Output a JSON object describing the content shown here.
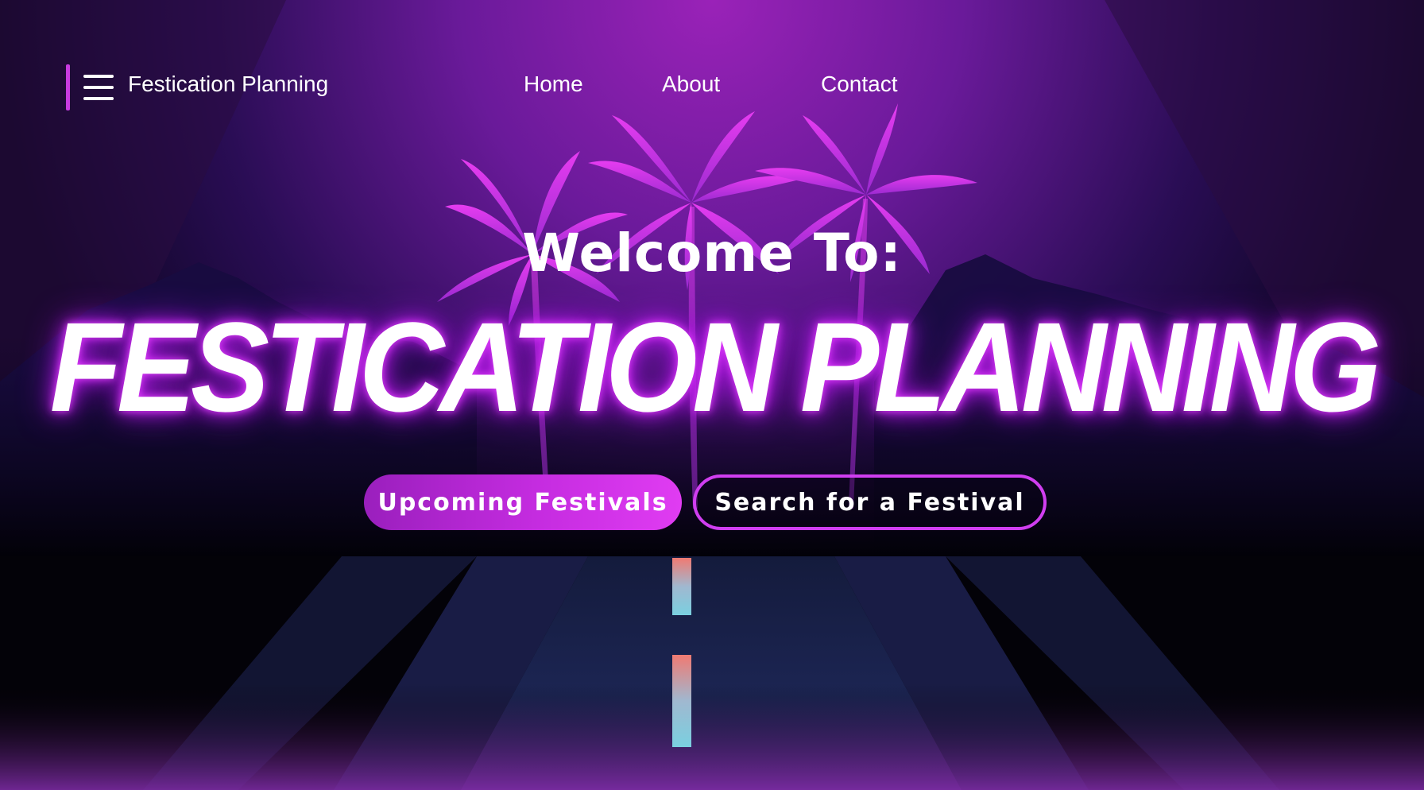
{
  "nav": {
    "brand": "Festication Planning",
    "menu_icon": "hamburger-menu-icon",
    "links": [
      "Home",
      "About",
      "Contact"
    ]
  },
  "hero": {
    "welcome": "Welcome To:",
    "title": "FESTICATION PLANNING",
    "primary_button": "Upcoming Festivals",
    "secondary_button": "Search for a Festival"
  },
  "colors": {
    "accent": "#c83be0",
    "glow": "#e040fb",
    "button_gradient_start": "#9a1fbd",
    "button_gradient_end": "#e03cf2",
    "sky_top": "#8a1fb0",
    "road": "#1b2450"
  }
}
